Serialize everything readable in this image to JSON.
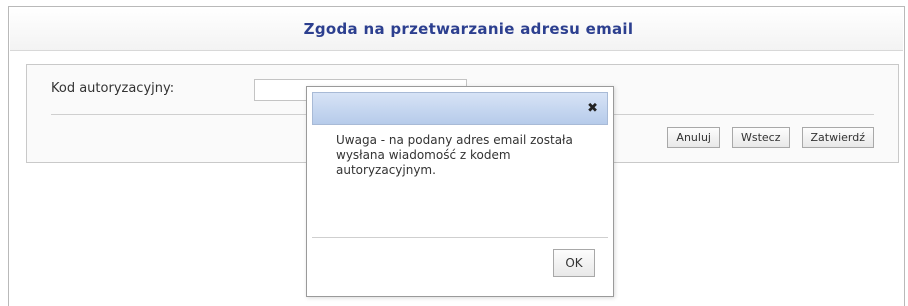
{
  "page": {
    "title": "Zgoda na przetwarzanie adresu email"
  },
  "form": {
    "auth_code_label": "Kod autoryzacyjny:",
    "auth_code_value": "",
    "buttons": {
      "cancel": "Anuluj",
      "back": "Wstecz",
      "confirm": "Zatwierdź"
    }
  },
  "dialog": {
    "close_icon": "close-icon",
    "close_glyph": "✖",
    "message": "Uwaga - na podany adres email została wysłana wiadomość z kodem autoryzacyjnym.",
    "ok_label": "OK"
  },
  "colors": {
    "title": "#2c3f8f",
    "dialog_titlebar": "#c6d7f0"
  }
}
